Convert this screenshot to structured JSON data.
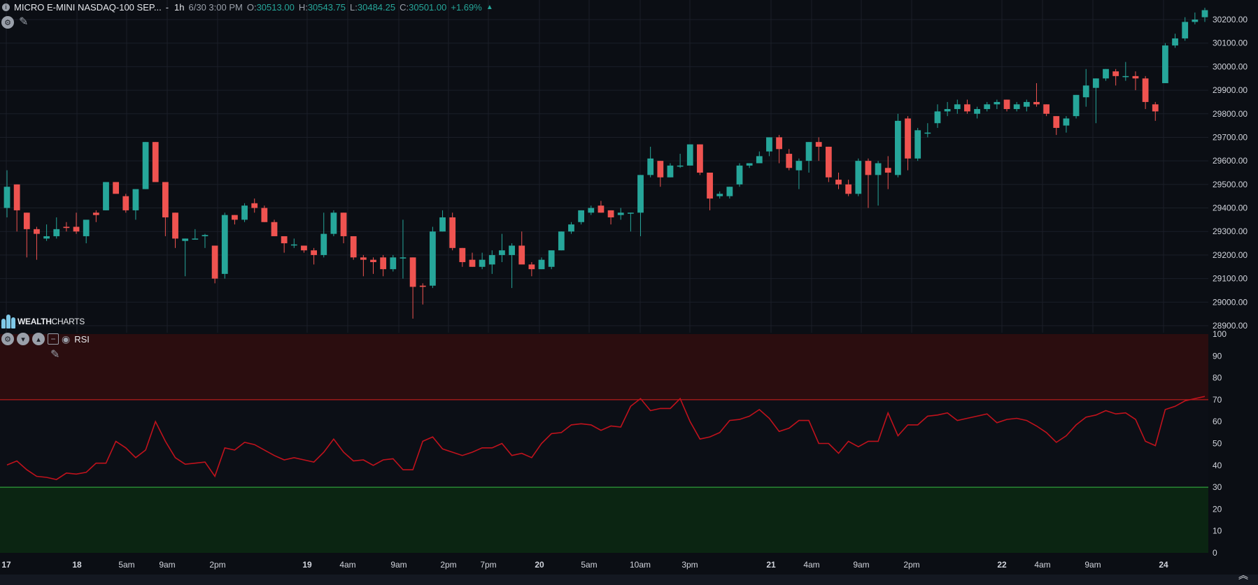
{
  "header": {
    "symbol": "MICRO E-MINI NASDAQ-100 SEP...",
    "timeframe": "1h",
    "datetime": "6/30 3:00 PM",
    "open_label": "O:",
    "open": "30513.00",
    "high_label": "H:",
    "high": "30543.75",
    "low_label": "L:",
    "low": "30484.25",
    "close_label": "C:",
    "close": "30501.00",
    "change": "+1.69%",
    "change_arrow": "▲"
  },
  "logo": {
    "bold": "WEALTH",
    "thin": "CHARTS"
  },
  "indicator": {
    "name": "RSI"
  },
  "icons": {
    "settings": "settings-icon",
    "pencil": "pencil-icon",
    "move_down": "chevron-down-icon",
    "move_up": "chevron-up-icon",
    "minimize": "minimize-icon",
    "visibility": "eye-icon",
    "collapse": "double-chevron-up-icon"
  },
  "colors": {
    "background": "#0b0e14",
    "bull": "#26a69a",
    "bear": "#ef5350",
    "rsi_line": "#c0121c",
    "overbought_zone": "#2b0d0f",
    "oversold_zone": "#0b2512",
    "overbought_line": "#b71c1c",
    "oversold_line": "#2e9e3a",
    "grid": "#1b1f28",
    "axis_text": "#d1d4dc"
  },
  "chart_data": [
    {
      "type": "candlestick",
      "y_axis_ticks": [
        "30200.00",
        "30100.00",
        "30000.00",
        "29900.00",
        "29800.00",
        "29700.00",
        "29600.00",
        "29500.00",
        "29400.00",
        "29300.00",
        "29200.00",
        "29100.00",
        "29000.00",
        "28900.00"
      ],
      "ylim": [
        28880,
        30250
      ],
      "x_ticks": [
        "17",
        "18",
        "5am",
        "9am",
        "2pm",
        "19",
        "4am",
        "9am",
        "2pm",
        "7pm",
        "20",
        "5am",
        "10am",
        "3pm",
        "21",
        "4am",
        "9am",
        "2pm",
        "22",
        "4am",
        "9am",
        "24"
      ],
      "candles": [
        {
          "o": 29400,
          "h": 29560,
          "l": 29360,
          "c": 29490
        },
        {
          "o": 29500,
          "h": 29500,
          "l": 29300,
          "c": 29390
        },
        {
          "o": 29380,
          "h": 29380,
          "l": 29190,
          "c": 29310
        },
        {
          "o": 29310,
          "h": 29320,
          "l": 29180,
          "c": 29290
        },
        {
          "o": 29270,
          "h": 29330,
          "l": 29260,
          "c": 29280
        },
        {
          "o": 29280,
          "h": 29360,
          "l": 29270,
          "c": 29310
        },
        {
          "o": 29320,
          "h": 29340,
          "l": 29300,
          "c": 29315
        },
        {
          "o": 29320,
          "h": 29380,
          "l": 29290,
          "c": 29300
        },
        {
          "o": 29280,
          "h": 29330,
          "l": 29250,
          "c": 29350
        },
        {
          "o": 29380,
          "h": 29390,
          "l": 29340,
          "c": 29370
        },
        {
          "o": 29390,
          "h": 29510,
          "l": 29390,
          "c": 29510
        },
        {
          "o": 29510,
          "h": 29510,
          "l": 29470,
          "c": 29460
        },
        {
          "o": 29450,
          "h": 29460,
          "l": 29380,
          "c": 29390
        },
        {
          "o": 29390,
          "h": 29450,
          "l": 29350,
          "c": 29480
        },
        {
          "o": 29480,
          "h": 29680,
          "l": 29480,
          "c": 29680
        },
        {
          "o": 29680,
          "h": 29680,
          "l": 29520,
          "c": 29510
        },
        {
          "o": 29510,
          "h": 29510,
          "l": 29280,
          "c": 29360
        },
        {
          "o": 29380,
          "h": 29380,
          "l": 29230,
          "c": 29270
        },
        {
          "o": 29260,
          "h": 29270,
          "l": 29110,
          "c": 29270
        },
        {
          "o": 29270,
          "h": 29310,
          "l": 29270,
          "c": 29270
        },
        {
          "o": 29280,
          "h": 29290,
          "l": 29230,
          "c": 29285
        },
        {
          "o": 29240,
          "h": 29240,
          "l": 29080,
          "c": 29100
        },
        {
          "o": 29120,
          "h": 29380,
          "l": 29100,
          "c": 29370
        },
        {
          "o": 29370,
          "h": 29370,
          "l": 29330,
          "c": 29350
        },
        {
          "o": 29350,
          "h": 29420,
          "l": 29340,
          "c": 29410
        },
        {
          "o": 29420,
          "h": 29440,
          "l": 29380,
          "c": 29400
        },
        {
          "o": 29400,
          "h": 29410,
          "l": 29340,
          "c": 29340
        },
        {
          "o": 29340,
          "h": 29350,
          "l": 29280,
          "c": 29280
        },
        {
          "o": 29280,
          "h": 29280,
          "l": 29210,
          "c": 29250
        },
        {
          "o": 29245,
          "h": 29270,
          "l": 29230,
          "c": 29245
        },
        {
          "o": 29240,
          "h": 29240,
          "l": 29210,
          "c": 29220
        },
        {
          "o": 29220,
          "h": 29230,
          "l": 29160,
          "c": 29200
        },
        {
          "o": 29200,
          "h": 29380,
          "l": 29190,
          "c": 29290
        },
        {
          "o": 29290,
          "h": 29390,
          "l": 29280,
          "c": 29380
        },
        {
          "o": 29380,
          "h": 29380,
          "l": 29250,
          "c": 29280
        },
        {
          "o": 29280,
          "h": 29280,
          "l": 29180,
          "c": 29190
        },
        {
          "o": 29190,
          "h": 29200,
          "l": 29110,
          "c": 29180
        },
        {
          "o": 29180,
          "h": 29190,
          "l": 29120,
          "c": 29170
        },
        {
          "o": 29190,
          "h": 29200,
          "l": 29110,
          "c": 29140
        },
        {
          "o": 29140,
          "h": 29200,
          "l": 29130,
          "c": 29190
        },
        {
          "o": 29190,
          "h": 29350,
          "l": 29100,
          "c": 29190
        },
        {
          "o": 29190,
          "h": 29190,
          "l": 28930,
          "c": 29065
        },
        {
          "o": 29070,
          "h": 29080,
          "l": 28990,
          "c": 29065
        },
        {
          "o": 29070,
          "h": 29320,
          "l": 29060,
          "c": 29300
        },
        {
          "o": 29300,
          "h": 29390,
          "l": 29300,
          "c": 29360
        },
        {
          "o": 29360,
          "h": 29380,
          "l": 29220,
          "c": 29230
        },
        {
          "o": 29230,
          "h": 29230,
          "l": 29150,
          "c": 29170
        },
        {
          "o": 29180,
          "h": 29210,
          "l": 29150,
          "c": 29150
        },
        {
          "o": 29150,
          "h": 29210,
          "l": 29140,
          "c": 29180
        },
        {
          "o": 29160,
          "h": 29220,
          "l": 29120,
          "c": 29200
        },
        {
          "o": 29200,
          "h": 29290,
          "l": 29170,
          "c": 29220
        },
        {
          "o": 29200,
          "h": 29250,
          "l": 29060,
          "c": 29240
        },
        {
          "o": 29240,
          "h": 29300,
          "l": 29200,
          "c": 29160
        },
        {
          "o": 29160,
          "h": 29170,
          "l": 29110,
          "c": 29140
        },
        {
          "o": 29140,
          "h": 29190,
          "l": 29140,
          "c": 29180
        },
        {
          "o": 29150,
          "h": 29200,
          "l": 29140,
          "c": 29220
        },
        {
          "o": 29220,
          "h": 29300,
          "l": 29220,
          "c": 29300
        },
        {
          "o": 29300,
          "h": 29340,
          "l": 29290,
          "c": 29330
        },
        {
          "o": 29340,
          "h": 29390,
          "l": 29330,
          "c": 29390
        },
        {
          "o": 29380,
          "h": 29410,
          "l": 29370,
          "c": 29400
        },
        {
          "o": 29410,
          "h": 29430,
          "l": 29380,
          "c": 29380
        },
        {
          "o": 29390,
          "h": 29390,
          "l": 29330,
          "c": 29360
        },
        {
          "o": 29370,
          "h": 29400,
          "l": 29350,
          "c": 29380
        },
        {
          "o": 29380,
          "h": 29380,
          "l": 29300,
          "c": 29380
        },
        {
          "o": 29380,
          "h": 29540,
          "l": 29280,
          "c": 29540
        },
        {
          "o": 29540,
          "h": 29660,
          "l": 29530,
          "c": 29610
        },
        {
          "o": 29600,
          "h": 29600,
          "l": 29490,
          "c": 29530
        },
        {
          "o": 29530,
          "h": 29590,
          "l": 29530,
          "c": 29580
        },
        {
          "o": 29580,
          "h": 29630,
          "l": 29570,
          "c": 29580
        },
        {
          "o": 29580,
          "h": 29670,
          "l": 29580,
          "c": 29670
        },
        {
          "o": 29670,
          "h": 29670,
          "l": 29540,
          "c": 29550
        },
        {
          "o": 29550,
          "h": 29550,
          "l": 29390,
          "c": 29440
        },
        {
          "o": 29450,
          "h": 29470,
          "l": 29440,
          "c": 29460
        },
        {
          "o": 29450,
          "h": 29490,
          "l": 29440,
          "c": 29490
        },
        {
          "o": 29500,
          "h": 29590,
          "l": 29490,
          "c": 29580
        },
        {
          "o": 29580,
          "h": 29590,
          "l": 29570,
          "c": 29590
        },
        {
          "o": 29590,
          "h": 29640,
          "l": 29590,
          "c": 29620
        },
        {
          "o": 29640,
          "h": 29700,
          "l": 29620,
          "c": 29700
        },
        {
          "o": 29700,
          "h": 29710,
          "l": 29590,
          "c": 29650
        },
        {
          "o": 29630,
          "h": 29650,
          "l": 29560,
          "c": 29570
        },
        {
          "o": 29560,
          "h": 29610,
          "l": 29480,
          "c": 29600
        },
        {
          "o": 29600,
          "h": 29680,
          "l": 29550,
          "c": 29680
        },
        {
          "o": 29680,
          "h": 29700,
          "l": 29600,
          "c": 29660
        },
        {
          "o": 29660,
          "h": 29660,
          "l": 29510,
          "c": 29530
        },
        {
          "o": 29520,
          "h": 29550,
          "l": 29480,
          "c": 29500
        },
        {
          "o": 29500,
          "h": 29520,
          "l": 29450,
          "c": 29460
        },
        {
          "o": 29460,
          "h": 29610,
          "l": 29450,
          "c": 29600
        },
        {
          "o": 29600,
          "h": 29610,
          "l": 29400,
          "c": 29540
        },
        {
          "o": 29540,
          "h": 29600,
          "l": 29410,
          "c": 29590
        },
        {
          "o": 29570,
          "h": 29620,
          "l": 29480,
          "c": 29550
        },
        {
          "o": 29540,
          "h": 29800,
          "l": 29530,
          "c": 29770
        },
        {
          "o": 29780,
          "h": 29790,
          "l": 29560,
          "c": 29610
        },
        {
          "o": 29610,
          "h": 29740,
          "l": 29600,
          "c": 29730
        },
        {
          "o": 29720,
          "h": 29760,
          "l": 29700,
          "c": 29720
        },
        {
          "o": 29760,
          "h": 29840,
          "l": 29740,
          "c": 29810
        },
        {
          "o": 29810,
          "h": 29850,
          "l": 29790,
          "c": 29820
        },
        {
          "o": 29820,
          "h": 29860,
          "l": 29800,
          "c": 29840
        },
        {
          "o": 29840,
          "h": 29860,
          "l": 29800,
          "c": 29810
        },
        {
          "o": 29800,
          "h": 29830,
          "l": 29780,
          "c": 29820
        },
        {
          "o": 29820,
          "h": 29850,
          "l": 29810,
          "c": 29840
        },
        {
          "o": 29840,
          "h": 29860,
          "l": 29820,
          "c": 29850
        },
        {
          "o": 29860,
          "h": 29860,
          "l": 29810,
          "c": 29820
        },
        {
          "o": 29820,
          "h": 29850,
          "l": 29810,
          "c": 29840
        },
        {
          "o": 29830,
          "h": 29860,
          "l": 29810,
          "c": 29850
        },
        {
          "o": 29850,
          "h": 29930,
          "l": 29830,
          "c": 29840
        },
        {
          "o": 29840,
          "h": 29840,
          "l": 29790,
          "c": 29800
        },
        {
          "o": 29790,
          "h": 29790,
          "l": 29710,
          "c": 29740
        },
        {
          "o": 29750,
          "h": 29790,
          "l": 29720,
          "c": 29780
        },
        {
          "o": 29790,
          "h": 29880,
          "l": 29780,
          "c": 29880
        },
        {
          "o": 29870,
          "h": 29990,
          "l": 29830,
          "c": 29920
        },
        {
          "o": 29910,
          "h": 29950,
          "l": 29760,
          "c": 29950
        },
        {
          "o": 29950,
          "h": 29990,
          "l": 29940,
          "c": 29990
        },
        {
          "o": 29980,
          "h": 29990,
          "l": 29920,
          "c": 29960
        },
        {
          "o": 29960,
          "h": 30020,
          "l": 29940,
          "c": 29960
        },
        {
          "o": 29960,
          "h": 29980,
          "l": 29900,
          "c": 29950
        },
        {
          "o": 29950,
          "h": 29960,
          "l": 29820,
          "c": 29850
        },
        {
          "o": 29840,
          "h": 29850,
          "l": 29770,
          "c": 29810
        },
        {
          "o": 29930,
          "h": 30100,
          "l": 29930,
          "c": 30090
        },
        {
          "o": 30090,
          "h": 30140,
          "l": 30080,
          "c": 30120
        },
        {
          "o": 30120,
          "h": 30210,
          "l": 30110,
          "c": 30190
        },
        {
          "o": 30190,
          "h": 30230,
          "l": 30180,
          "c": 30200
        },
        {
          "o": 30210,
          "h": 30250,
          "l": 30190,
          "c": 30240
        }
      ]
    },
    {
      "type": "line",
      "title": "RSI",
      "y_axis_ticks": [
        "100",
        "90",
        "80",
        "70",
        "60",
        "50",
        "40",
        "30",
        "20",
        "10",
        "0"
      ],
      "ylim": [
        0,
        100
      ],
      "overbought": 70,
      "oversold": 30,
      "values": [
        40.2,
        42,
        38,
        35,
        34.5,
        33.5,
        36.5,
        36,
        36.8,
        41,
        41,
        51,
        48,
        43.5,
        47,
        60,
        51,
        43.5,
        40.5,
        41,
        41.5,
        35,
        48,
        47,
        50.5,
        49.5,
        47,
        44.5,
        42.5,
        43.5,
        42.5,
        41.5,
        46,
        52,
        46,
        42,
        42.5,
        40,
        42.5,
        43,
        38,
        38,
        51,
        53,
        47.5,
        46,
        44.5,
        46,
        48,
        48,
        50,
        44.5,
        45.5,
        43.5,
        50,
        54.5,
        55,
        58.5,
        59,
        58.5,
        56,
        58,
        57.5,
        67,
        70.5,
        65,
        66,
        66,
        70.5,
        60,
        52,
        53,
        55,
        60.5,
        61,
        62.5,
        65.5,
        61.5,
        55.5,
        57,
        60.5,
        60.5,
        50,
        50,
        45.5,
        51,
        48.5,
        51,
        51,
        64,
        53.5,
        58.5,
        58.5,
        62.5,
        63,
        64,
        60.5,
        61.5,
        62.5,
        63.5,
        59.5,
        61,
        61.5,
        60.5,
        58,
        55,
        50.5,
        53.5,
        58.5,
        62,
        63,
        65,
        63.5,
        64,
        61,
        51,
        49,
        65.5,
        67,
        69.5,
        70.5,
        71.5
      ]
    }
  ]
}
